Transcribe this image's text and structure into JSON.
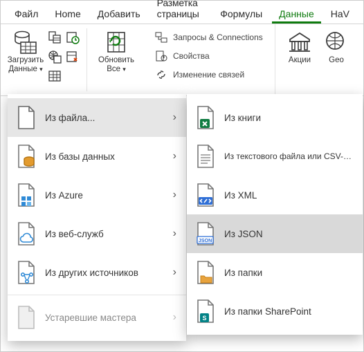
{
  "tabs": {
    "file": "Файл",
    "home": "Home",
    "add": "Добавить",
    "page_layout": "Разметка страницы",
    "formulas": "Формулы",
    "data": "Данные",
    "view_fragment": "НаV"
  },
  "ribbon": {
    "get_data_line1": "Загрузить",
    "get_data_line2": "Данные",
    "refresh_line1": "Обновить",
    "refresh_line2": "Все",
    "queries": "Запросы & Connections",
    "properties": "Свойства",
    "edit_links": "Изменение связей",
    "stocks": "Акции",
    "geo_fragment": "Geo"
  },
  "menu_left": {
    "from_file": "Из файла...",
    "from_db": "Из базы данных",
    "from_azure": "Из Azure",
    "from_web": "Из веб-служб",
    "from_other": "Из других источников",
    "legacy": "Устаревшие мастера"
  },
  "menu_right": {
    "from_workbook": "Из книги",
    "from_csv": "Из текстового файла или CSV-файла",
    "from_xml": "Из XML",
    "from_json": "Из JSON",
    "from_folder": "Из папки",
    "from_sharepoint": "Из папки SharePoint"
  }
}
